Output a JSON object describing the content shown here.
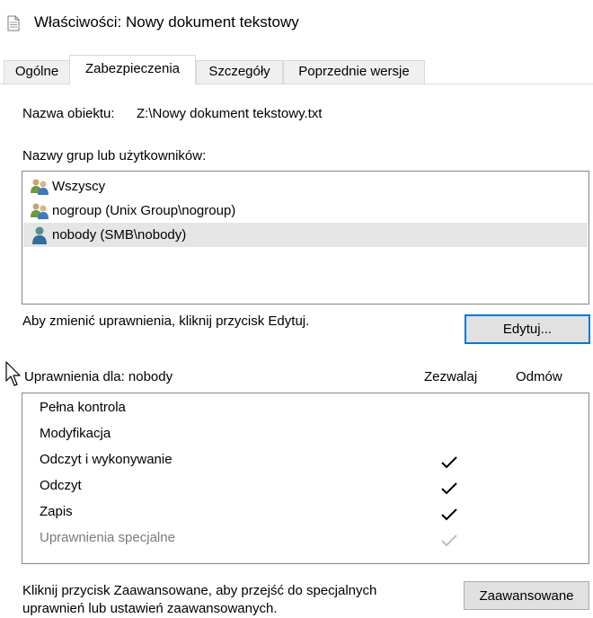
{
  "window": {
    "title": "Właściwości: Nowy dokument tekstowy",
    "icon": "document-icon"
  },
  "tabs": [
    {
      "label": "Ogólne",
      "active": false
    },
    {
      "label": "Zabezpieczenia",
      "active": true
    },
    {
      "label": "Szczegóły",
      "active": false
    },
    {
      "label": "Poprzednie wersje",
      "active": false
    }
  ],
  "object": {
    "label": "Nazwa obiektu:",
    "value": "Z:\\Nowy dokument tekstowy.txt"
  },
  "groups": {
    "label": "Nazwy grup lub użytkowników:",
    "items": [
      {
        "name": "Wszyscy",
        "icon": "group-icon",
        "selected": false
      },
      {
        "name": "nogroup (Unix Group\\nogroup)",
        "icon": "group-icon",
        "selected": false
      },
      {
        "name": "nobody (SMB\\nobody)",
        "icon": "user-icon",
        "selected": true
      }
    ]
  },
  "edit": {
    "hint": "Aby zmienić uprawnienia, kliknij przycisk Edytuj.",
    "button_label": "Edytuj..."
  },
  "permissions": {
    "header": "Uprawnienia dla: nobody",
    "allow_label": "Zezwalaj",
    "deny_label": "Odmów",
    "rows": [
      {
        "name": "Pełna kontrola",
        "allow": false,
        "deny": false
      },
      {
        "name": "Modyfikacja",
        "allow": false,
        "deny": false
      },
      {
        "name": "Odczyt i wykonywanie",
        "allow": true,
        "deny": false
      },
      {
        "name": "Odczyt",
        "allow": true,
        "deny": false
      },
      {
        "name": "Zapis",
        "allow": true,
        "deny": false
      },
      {
        "name": "Uprawnienia specjalne",
        "allow": true,
        "deny": false,
        "allow_disabled": true
      }
    ]
  },
  "advanced": {
    "hint_line1": "Kliknij przycisk Zaawansowane, aby przejść do specjalnych",
    "hint_line2": "uprawnień lub ustawień zaawansowanych.",
    "button_label": "Zaawansowane"
  },
  "colors": {
    "accent": "#0078d7",
    "selection": "#e5e5e5",
    "disabled_check": "#bfbfbf"
  }
}
